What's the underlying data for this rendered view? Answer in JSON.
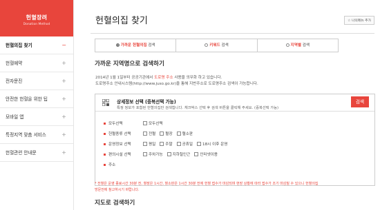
{
  "sidebar": {
    "header_title": "헌혈장려",
    "header_sub": "Donation Method",
    "items": [
      {
        "label": "헌혈의집 찾기",
        "toggle": "−"
      },
      {
        "label": "헌혈예약",
        "toggle": "+"
      },
      {
        "label": "전자문진",
        "toggle": "+"
      },
      {
        "label": "안전한 헌혈을 위한 팁",
        "toggle": "+"
      },
      {
        "label": "모바일 앱",
        "toggle": "+"
      },
      {
        "label": "특정지역 맞춤 서비스",
        "toggle": "+"
      },
      {
        "label": "헌혈관련 안내문",
        "toggle": "+"
      }
    ]
  },
  "header": {
    "title": "헌혈의집 찾기",
    "sitemap_label": "☆ 나의메뉴 추가"
  },
  "tabs": [
    {
      "label": "가까운 헌혈의집",
      "suffix": " 검색",
      "selected": true
    },
    {
      "label": "키워드",
      "suffix": " 검색",
      "selected": false
    },
    {
      "label": "지역별",
      "suffix": " 검색",
      "selected": false
    }
  ],
  "section1": {
    "title": "가까운 지역명으로 검색하기",
    "intro_line1_pre": "2014년 1월 1일부터 공공기관에서 ",
    "intro_line1_hl": "도로명 주소",
    "intro_line1_post": " 사용을 의무화 하고 있습니다.",
    "intro_line2": "도로명주소 안내시스템(http://www.juso.go.kr)을 통해 지번주소로 도로명주소 검색이 가능합니다."
  },
  "detail": {
    "title": "상세정보 선택 (중복선택 가능)",
    "desc": "특정 정보가 포함된 헌혈의집만 검색합니다. 체크박스 선택 후 검색 버튼을 클릭해 주세요. (중복선택 가능)",
    "search_label": "검색",
    "rows": [
      {
        "label": "모두선택",
        "options": [
          "모두선택"
        ]
      },
      {
        "label": "헌혈종류 선택",
        "options": [
          "전혈",
          "혈장",
          "혈소판"
        ]
      },
      {
        "label": "운영정보 선택",
        "options": [
          "평일",
          "주말",
          "공휴일",
          "18시 이후 운영"
        ]
      },
      {
        "label": "편의시설 선택",
        "options": [
          "주차가능",
          "지하철인근",
          "인터넷이용"
        ]
      },
      {
        "label": "주소",
        "options": []
      }
    ]
  },
  "notice": {
    "line1": "* 전혈은 운영 종료시간 30분 전, 혈장은 1시간, 혈소판은 1시간 30분 전에 헌혈 접수가 마감되며 현장 상황에 따라 접수가 조기 마감될 수 있으니 헌혈의집",
    "line2": "방문전에 참고하시기 바랍니다."
  },
  "section2": {
    "title": "지도로 검색하기"
  }
}
